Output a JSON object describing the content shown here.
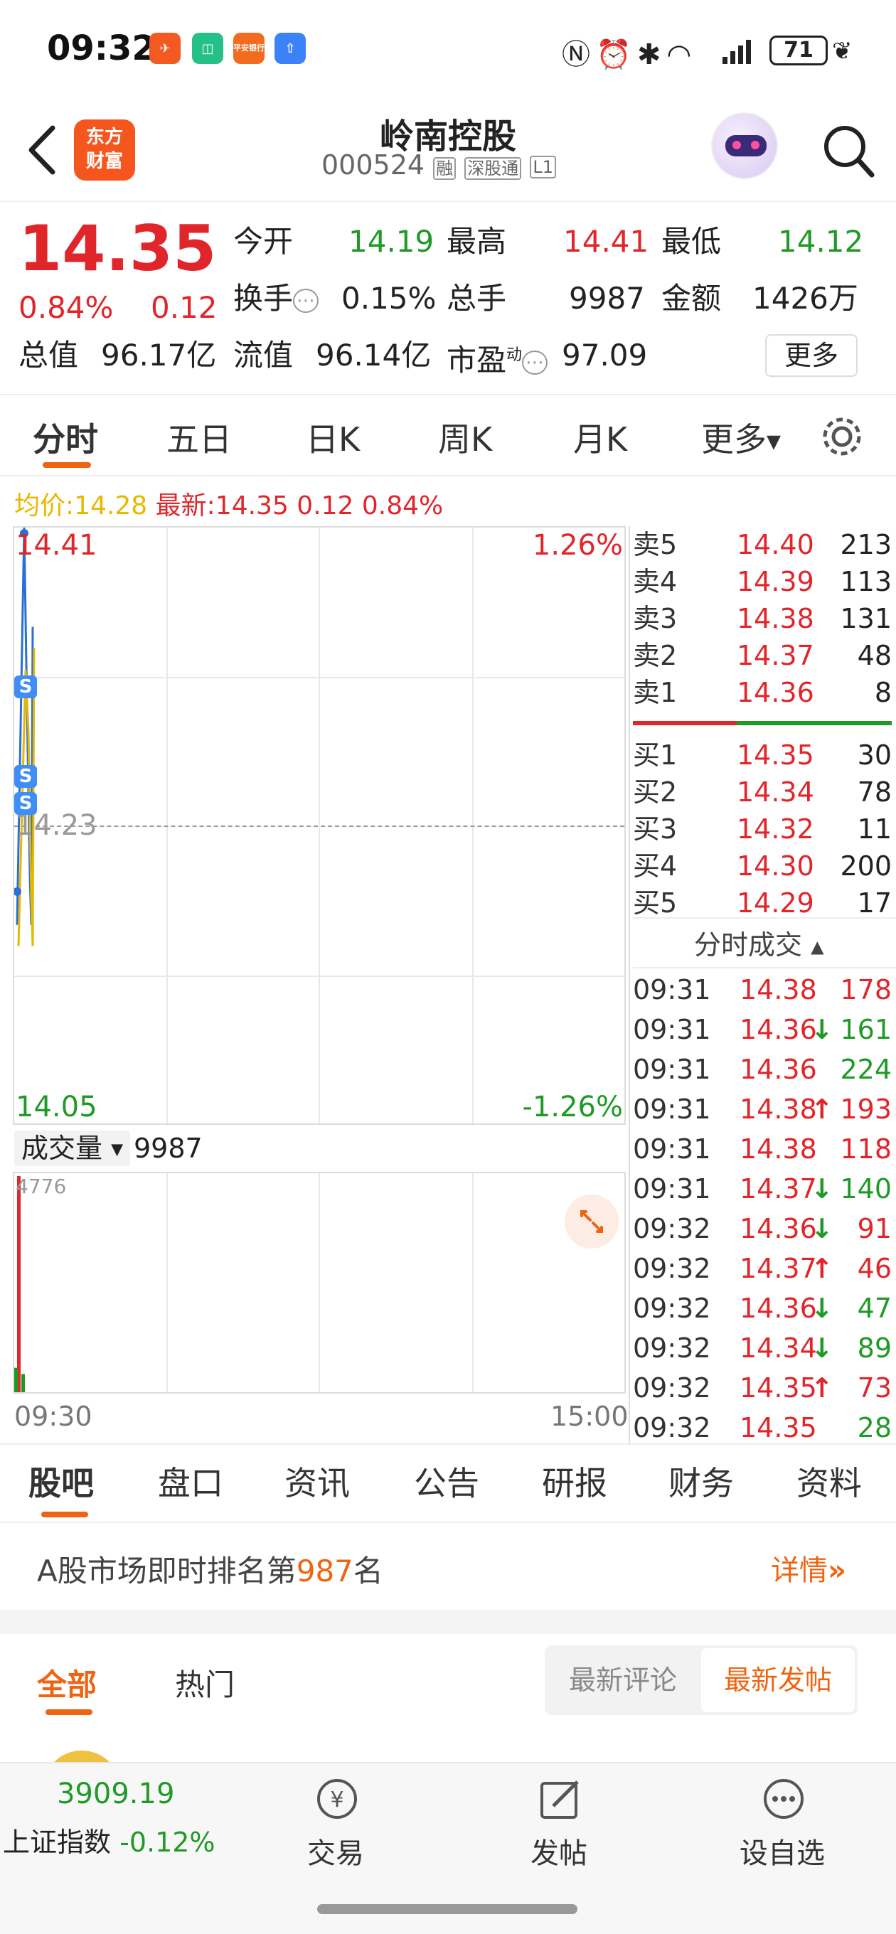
{
  "status_bar": {
    "time": "09:32",
    "battery": "71",
    "app_icon_labels": [
      "平安银行"
    ]
  },
  "header": {
    "title": "岭南控股",
    "code": "000524",
    "badges": [
      "融",
      "深股通",
      "L1"
    ],
    "logo_text": "东方财富"
  },
  "quote": {
    "price": "14.35",
    "change_pct": "0.84%",
    "change": "0.12",
    "open_label": "今开",
    "open": "14.19",
    "high_label": "最高",
    "high": "14.41",
    "low_label": "最低",
    "low": "14.12",
    "turnover_label": "换手",
    "turnover": "0.15%",
    "volume_label": "总手",
    "volume": "9987",
    "amount_label": "金额",
    "amount": "1426万",
    "mcap_label": "总值",
    "mcap": "96.17亿",
    "float_label": "流值",
    "float_cap": "96.14亿",
    "pe_label": "市盈",
    "pe_sup": "动",
    "pe": "97.09",
    "more_button": "更多"
  },
  "chart_tabs": [
    "分时",
    "五日",
    "日K",
    "周K",
    "月K",
    "更多"
  ],
  "info_line": {
    "avg_label": "均价:",
    "avg": "14.28",
    "latest_label": "最新:",
    "latest": "14.35 0.12 0.84%"
  },
  "chart": {
    "top_price": "14.41",
    "top_pct": "1.26%",
    "mid_price": "14.23",
    "bottom_price": "14.05",
    "bottom_pct": "-1.26%",
    "volume_label": "成交量",
    "volume_value": "9987",
    "volume_max": "4776",
    "time_start": "09:30",
    "time_end": "15:00",
    "s_markers": [
      "S",
      "S",
      "S"
    ]
  },
  "chart_data": {
    "type": "line",
    "series": [
      {
        "values": [
          14.17,
          14.41,
          14.3,
          14.2,
          14.17,
          14.35
        ]
      }
    ],
    "ylim": [
      14.05,
      14.41
    ],
    "volume": {
      "values": [
        4776,
        300,
        500
      ]
    }
  },
  "order_book": {
    "asks": [
      {
        "label": "卖5",
        "price": "14.40",
        "vol": "213"
      },
      {
        "label": "卖4",
        "price": "14.39",
        "vol": "113"
      },
      {
        "label": "卖3",
        "price": "14.38",
        "vol": "131"
      },
      {
        "label": "卖2",
        "price": "14.37",
        "vol": "48"
      },
      {
        "label": "卖1",
        "price": "14.36",
        "vol": "8"
      }
    ],
    "bids": [
      {
        "label": "买1",
        "price": "14.35",
        "vol": "30"
      },
      {
        "label": "买2",
        "price": "14.34",
        "vol": "78"
      },
      {
        "label": "买3",
        "price": "14.32",
        "vol": "11"
      },
      {
        "label": "买4",
        "price": "14.30",
        "vol": "200"
      },
      {
        "label": "买5",
        "price": "14.29",
        "vol": "17"
      }
    ]
  },
  "trades_header": "分时成交",
  "trades": [
    {
      "time": "09:31",
      "price": "14.38",
      "arrow": "",
      "vol": "178",
      "color": "red"
    },
    {
      "time": "09:31",
      "price": "14.36",
      "arrow": "↓",
      "vol": "161",
      "color": "green"
    },
    {
      "time": "09:31",
      "price": "14.36",
      "arrow": "",
      "vol": "224",
      "color": "green"
    },
    {
      "time": "09:31",
      "price": "14.38",
      "arrow": "↑",
      "vol": "193",
      "color": "red"
    },
    {
      "time": "09:31",
      "price": "14.38",
      "arrow": "",
      "vol": "118",
      "color": "red"
    },
    {
      "time": "09:31",
      "price": "14.37",
      "arrow": "↓",
      "vol": "140",
      "color": "green"
    },
    {
      "time": "09:32",
      "price": "14.36",
      "arrow": "↓",
      "vol": "91",
      "color": "red"
    },
    {
      "time": "09:32",
      "price": "14.37",
      "arrow": "↑",
      "vol": "46",
      "color": "red"
    },
    {
      "time": "09:32",
      "price": "14.36",
      "arrow": "↓",
      "vol": "47",
      "color": "green"
    },
    {
      "time": "09:32",
      "price": "14.34",
      "arrow": "↓",
      "vol": "89",
      "color": "green"
    },
    {
      "time": "09:32",
      "price": "14.35",
      "arrow": "↑",
      "vol": "73",
      "color": "red"
    },
    {
      "time": "09:32",
      "price": "14.35",
      "arrow": "",
      "vol": "28",
      "color": "green"
    }
  ],
  "section_tabs": [
    "股吧",
    "盘口",
    "资讯",
    "公告",
    "研报",
    "财务",
    "资料"
  ],
  "ranking": {
    "prefix": "A股市场即时排名第",
    "rank": "987",
    "suffix": "名",
    "details": "详情"
  },
  "feed_tabs": {
    "all": "全部",
    "hot": "热门",
    "latest_comment": "最新评论",
    "latest_post": "最新发帖"
  },
  "bottom_nav": {
    "index_value": "3909.19",
    "index_label": "上证指数",
    "index_change": "-0.12%",
    "trade": "交易",
    "post": "发帖",
    "add_watch": "设自选"
  },
  "colors": {
    "up": "#e0262a",
    "down": "#1f9a26",
    "accent": "#ee6412",
    "avg_line": "#e8b800"
  }
}
